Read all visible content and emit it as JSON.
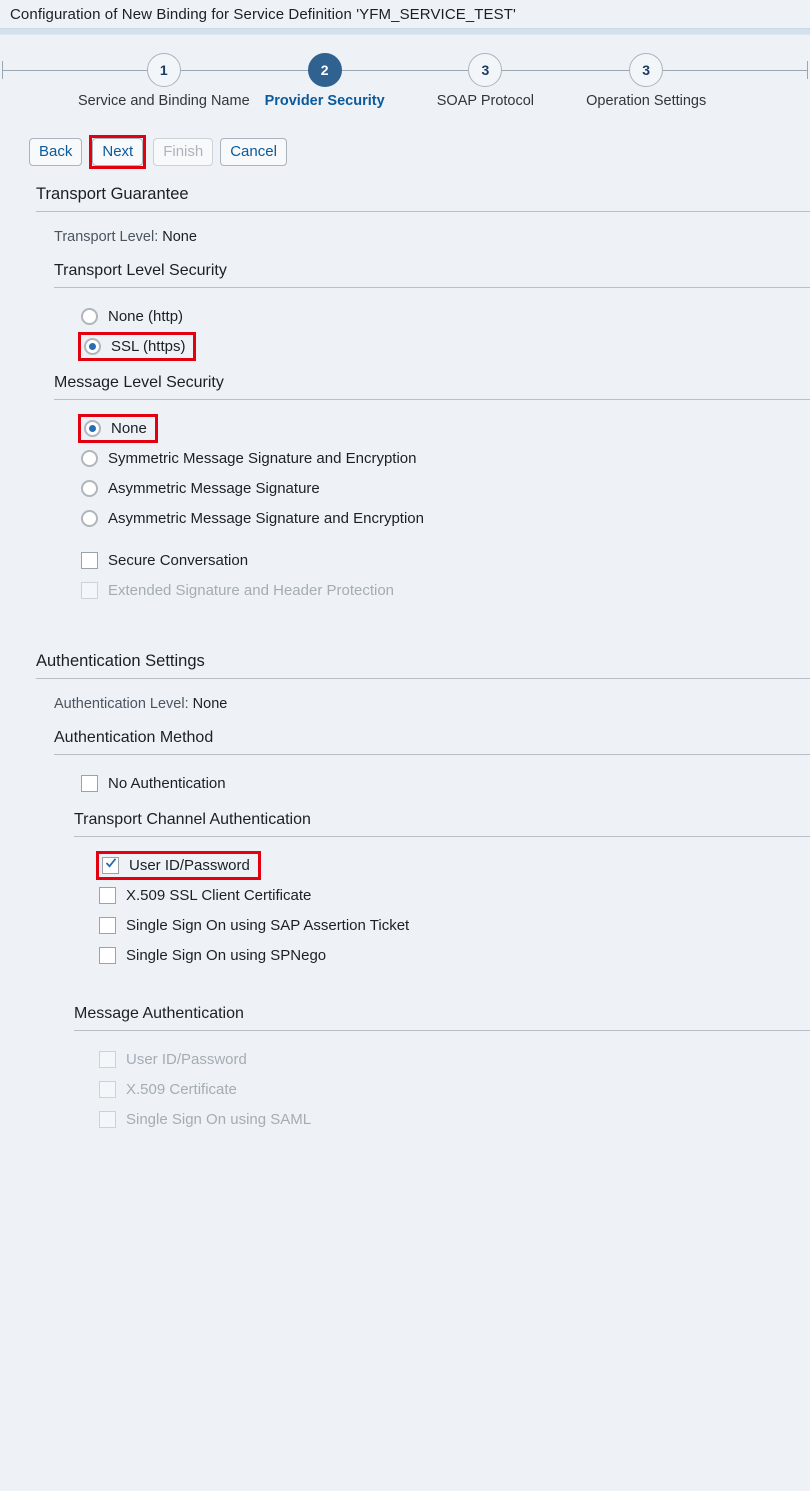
{
  "window": {
    "title": "Configuration of New Binding for Service Definition 'YFM_SERVICE_TEST'"
  },
  "colors": {
    "accent": "#0a5a9c",
    "active_step": "#2f6291",
    "highlight": "#e3000f",
    "background": "#eef2f6"
  },
  "roadmap": {
    "steps": [
      {
        "number": "1",
        "label": "Service and Binding Name",
        "active": false
      },
      {
        "number": "2",
        "label": "Provider Security",
        "active": true
      },
      {
        "number": "3",
        "label": "SOAP Protocol",
        "active": false
      },
      {
        "number": "3",
        "label": "Operation Settings",
        "active": false
      }
    ]
  },
  "buttons": {
    "back": "Back",
    "next": "Next",
    "finish": "Finish",
    "cancel": "Cancel"
  },
  "transport_guarantee": {
    "heading": "Transport Guarantee",
    "level_label": "Transport Level:",
    "level_value": "None",
    "transport_level_security": {
      "heading": "Transport Level Security",
      "options": [
        {
          "label": "None (http)",
          "checked": false,
          "highlighted": false
        },
        {
          "label": "SSL (https)",
          "checked": true,
          "highlighted": true
        }
      ]
    },
    "message_level_security": {
      "heading": "Message Level Security",
      "radios": [
        {
          "label": "None",
          "checked": true,
          "highlighted": true
        },
        {
          "label": "Symmetric Message Signature and Encryption",
          "checked": false,
          "highlighted": false
        },
        {
          "label": "Asymmetric Message Signature",
          "checked": false,
          "highlighted": false
        },
        {
          "label": "Asymmetric Message Signature and Encryption",
          "checked": false,
          "highlighted": false
        }
      ],
      "checkboxes": [
        {
          "label": "Secure Conversation",
          "checked": false,
          "disabled": false
        },
        {
          "label": "Extended Signature and Header Protection",
          "checked": false,
          "disabled": true
        }
      ]
    }
  },
  "authentication_settings": {
    "heading": "Authentication Settings",
    "level_label": "Authentication Level:",
    "level_value": "None",
    "authentication_method": {
      "heading": "Authentication Method",
      "checkboxes": [
        {
          "label": "No Authentication",
          "checked": false,
          "disabled": false
        }
      ]
    },
    "transport_channel_authentication": {
      "heading": "Transport Channel Authentication",
      "checkboxes": [
        {
          "label": "User ID/Password",
          "checked": true,
          "disabled": false,
          "highlighted": true
        },
        {
          "label": "X.509 SSL Client Certificate",
          "checked": false,
          "disabled": false,
          "highlighted": false
        },
        {
          "label": "Single Sign On using SAP Assertion Ticket",
          "checked": false,
          "disabled": false,
          "highlighted": false
        },
        {
          "label": "Single Sign On using SPNego",
          "checked": false,
          "disabled": false,
          "highlighted": false
        }
      ]
    },
    "message_authentication": {
      "heading": "Message Authentication",
      "checkboxes": [
        {
          "label": "User ID/Password",
          "checked": false,
          "disabled": true
        },
        {
          "label": "X.509 Certificate",
          "checked": false,
          "disabled": true
        },
        {
          "label": "Single Sign On using SAML",
          "checked": false,
          "disabled": true
        }
      ]
    }
  }
}
